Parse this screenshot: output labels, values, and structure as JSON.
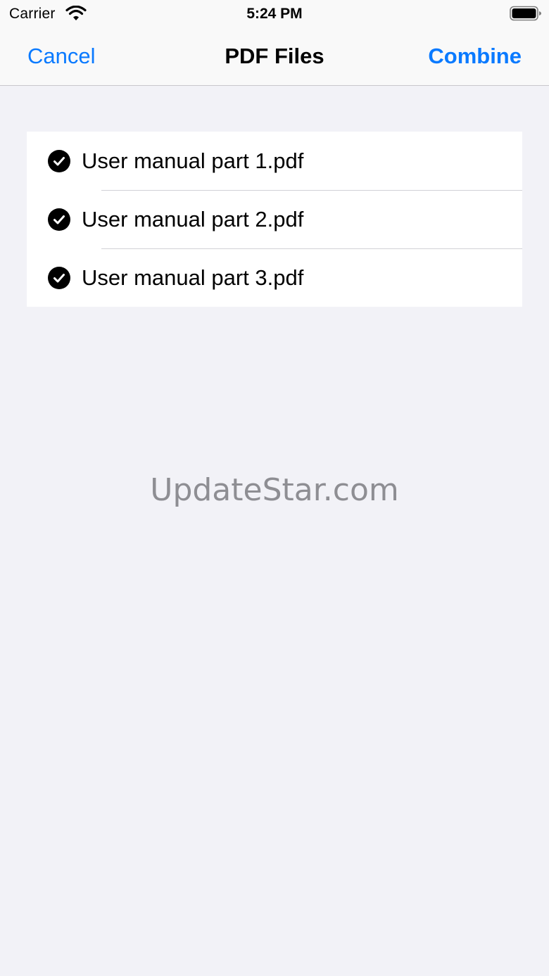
{
  "status_bar": {
    "carrier": "Carrier",
    "time": "5:24 PM",
    "wifi_icon": "wifi-icon",
    "battery_icon": "battery-full-icon"
  },
  "nav_bar": {
    "cancel_label": "Cancel",
    "title": "PDF Files",
    "combine_label": "Combine"
  },
  "files": [
    {
      "name": "User manual part 1.pdf",
      "checked": true
    },
    {
      "name": "User manual part 2.pdf",
      "checked": true
    },
    {
      "name": "User manual part 3.pdf",
      "checked": true
    }
  ],
  "watermark": "UpdateStar.com",
  "colors": {
    "accent": "#0a7aff",
    "background": "#f2f2f7",
    "bar": "#f9f9f9",
    "list_background": "#ffffff",
    "separator": "#d1d1d6",
    "watermark": "#8e8e93"
  }
}
